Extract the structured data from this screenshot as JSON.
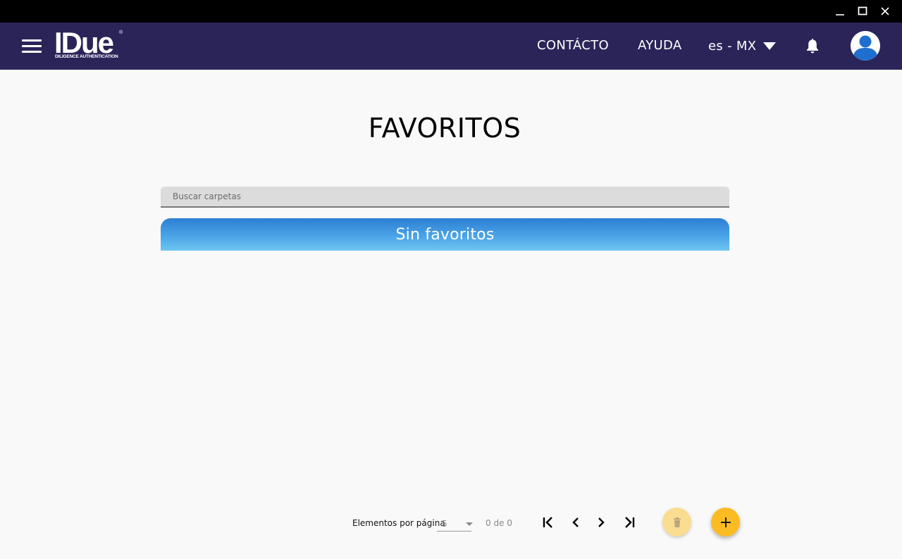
{
  "app": {
    "logo_text": "IDue",
    "logo_registered": "®",
    "logo_subtitle": "DILIGENCE AUTHENTICATION"
  },
  "window_controls": {
    "minimize_icon": "minimize-icon",
    "maximize_icon": "maximize-icon",
    "close_icon": "close-icon"
  },
  "header": {
    "menu_icon": "hamburger-menu-icon",
    "contact_label": "CONTÁCTO",
    "help_label": "AYUDA",
    "language_label": "es - MX",
    "notifications_icon": "bell-icon",
    "profile_icon": "user-avatar-icon"
  },
  "main": {
    "title": "FAVORITOS",
    "search": {
      "placeholder": "Buscar carpetas",
      "value": ""
    },
    "empty_message": "Sin favoritos"
  },
  "pagination": {
    "per_page_label": "Elementos por página",
    "per_page_value": "5",
    "range_text": "0 de 0",
    "first_icon": "first-page-icon",
    "prev_icon": "chevron-left-icon",
    "next_icon": "chevron-right-icon",
    "last_icon": "last-page-icon"
  },
  "actions": {
    "delete_icon": "trash-icon",
    "add_icon": "plus-icon"
  },
  "colors": {
    "header_bg": "#2b2459",
    "title_bar_bg": "#000000",
    "banner_gradient_top": "#2d7fd4",
    "banner_gradient_bottom": "#6ec6ef",
    "fab_add": "#fbbc23",
    "fab_delete_disabled": "#fbdd92",
    "avatar_blue": "#1e6fd0"
  }
}
